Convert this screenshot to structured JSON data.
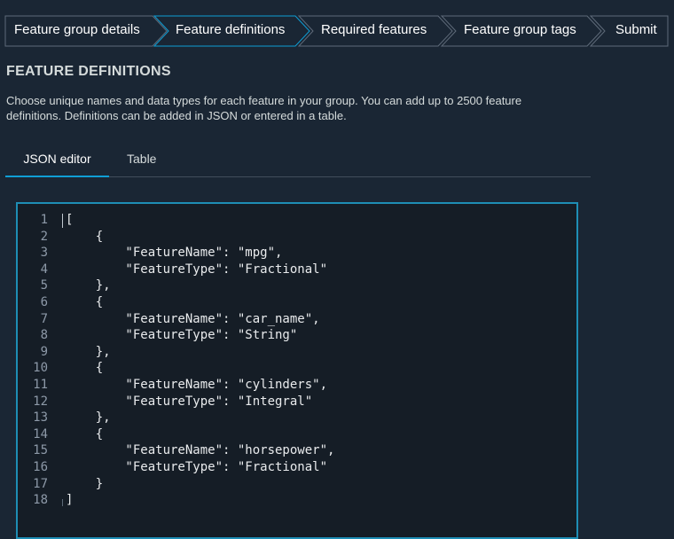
{
  "steps": [
    {
      "label": "Feature group details",
      "active": false
    },
    {
      "label": "Feature definitions",
      "active": true
    },
    {
      "label": "Required features",
      "active": false
    },
    {
      "label": "Feature group tags",
      "active": false
    },
    {
      "label": "Submit",
      "active": false
    }
  ],
  "section": {
    "title": "FEATURE DEFINITIONS",
    "description": "Choose unique names and data types for each feature in your group. You can add up to 2500 feature definitions. Definitions can be added in JSON or entered in a table."
  },
  "tabs": [
    {
      "label": "JSON editor",
      "active": true
    },
    {
      "label": "Table",
      "active": false
    }
  ],
  "editor": {
    "lines": [
      {
        "n": "1",
        "text": "["
      },
      {
        "n": "2",
        "text": "    {"
      },
      {
        "n": "3",
        "text": "        \"FeatureName\": \"mpg\","
      },
      {
        "n": "4",
        "text": "        \"FeatureType\": \"Fractional\""
      },
      {
        "n": "5",
        "text": "    },"
      },
      {
        "n": "6",
        "text": "    {"
      },
      {
        "n": "7",
        "text": "        \"FeatureName\": \"car_name\","
      },
      {
        "n": "8",
        "text": "        \"FeatureType\": \"String\""
      },
      {
        "n": "9",
        "text": "    },"
      },
      {
        "n": "10",
        "text": "    {"
      },
      {
        "n": "11",
        "text": "        \"FeatureName\": \"cylinders\","
      },
      {
        "n": "12",
        "text": "        \"FeatureType\": \"Integral\""
      },
      {
        "n": "13",
        "text": "    },"
      },
      {
        "n": "14",
        "text": "    {"
      },
      {
        "n": "15",
        "text": "        \"FeatureName\": \"horsepower\","
      },
      {
        "n": "16",
        "text": "        \"FeatureType\": \"Fractional\""
      },
      {
        "n": "17",
        "text": "    }"
      },
      {
        "n": "18",
        "text": "]"
      }
    ]
  },
  "colors": {
    "background": "#1a2634",
    "step_border": "#5f6b7a",
    "step_active_border": "#0f9ed5",
    "tab_active_underline": "#0f9ed5",
    "editor_border": "#1e8eb5"
  }
}
